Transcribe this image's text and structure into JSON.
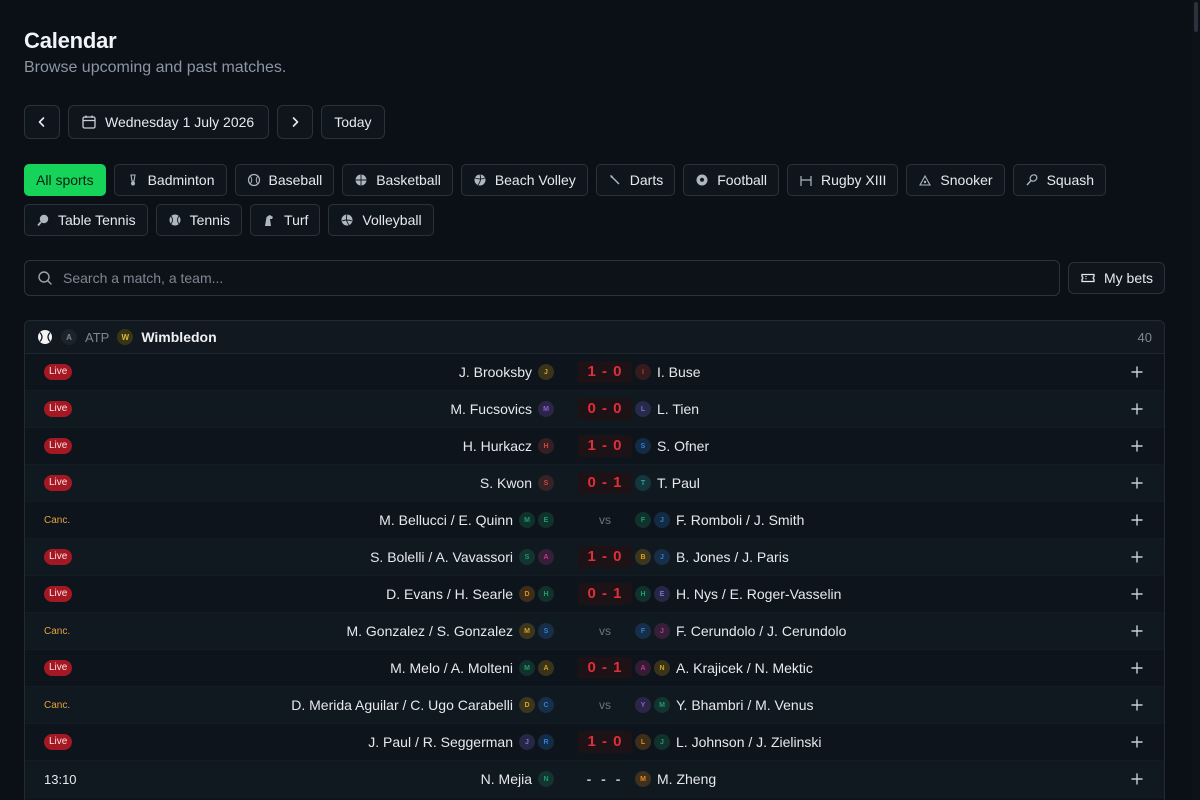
{
  "header": {
    "title": "Calendar",
    "subtitle": "Browse upcoming and past matches."
  },
  "datebar": {
    "date_label": "Wednesday 1 July 2026",
    "today_label": "Today"
  },
  "sports": [
    {
      "label": "All sports",
      "icon": "",
      "active": true
    },
    {
      "label": "Badminton",
      "icon": "badminton-icon"
    },
    {
      "label": "Baseball",
      "icon": "baseball-icon"
    },
    {
      "label": "Basketball",
      "icon": "basketball-icon"
    },
    {
      "label": "Beach Volley",
      "icon": "beach-volley-icon"
    },
    {
      "label": "Darts",
      "icon": "darts-icon"
    },
    {
      "label": "Football",
      "icon": "football-icon"
    },
    {
      "label": "Rugby XIII",
      "icon": "rugby-icon"
    },
    {
      "label": "Snooker",
      "icon": "snooker-icon"
    },
    {
      "label": "Squash",
      "icon": "squash-icon"
    },
    {
      "label": "Table Tennis",
      "icon": "table-tennis-icon"
    },
    {
      "label": "Tennis",
      "icon": "tennis-icon"
    },
    {
      "label": "Turf",
      "icon": "horse-icon"
    },
    {
      "label": "Volleyball",
      "icon": "volleyball-icon"
    }
  ],
  "search": {
    "placeholder": "Search a match, a team...",
    "value": ""
  },
  "my_bets": {
    "label": "My bets"
  },
  "tournament": {
    "circuit_badge": "A",
    "circuit": "ATP",
    "tournament_badge": "W",
    "name": "Wimbledon",
    "count": "40"
  },
  "colors": {
    "accent": "#16d35a",
    "live": "#a41823",
    "score": "#e02e3a",
    "cancelled": "#e6a23c",
    "background": "#0b1016"
  },
  "matches": [
    {
      "status": "Live",
      "status_type": "live",
      "home": "J. Brooksby",
      "home_badges": [
        {
          "l": "J",
          "c": "#d9a21b"
        }
      ],
      "result": "1 - 0",
      "result_type": "score",
      "away": "I. Buse",
      "away_badges": [
        {
          "l": "I",
          "c": "#c0392b"
        }
      ]
    },
    {
      "status": "Live",
      "status_type": "live",
      "home": "M. Fucsovics",
      "home_badges": [
        {
          "l": "M",
          "c": "#8e5bd6"
        }
      ],
      "result": "0 - 0",
      "result_type": "score",
      "away": "L. Tien",
      "away_badges": [
        {
          "l": "L",
          "c": "#7b6fd6"
        }
      ]
    },
    {
      "status": "Live",
      "status_type": "live",
      "home": "H. Hurkacz",
      "home_badges": [
        {
          "l": "H",
          "c": "#c44b3a"
        }
      ],
      "result": "1 - 0",
      "result_type": "score",
      "away": "S. Ofner",
      "away_badges": [
        {
          "l": "S",
          "c": "#2f7fd6"
        }
      ]
    },
    {
      "status": "Live",
      "status_type": "live",
      "home": "S. Kwon",
      "home_badges": [
        {
          "l": "S",
          "c": "#c44b3a"
        }
      ],
      "result": "0 - 1",
      "result_type": "score",
      "away": "T. Paul",
      "away_badges": [
        {
          "l": "T",
          "c": "#2aa5a0"
        }
      ]
    },
    {
      "status": "Canc.",
      "status_type": "canc",
      "home": "M. Bellucci / E. Quinn",
      "home_badges": [
        {
          "l": "M",
          "c": "#1f9d6b"
        },
        {
          "l": "E",
          "c": "#1f9d6b"
        }
      ],
      "result": "vs",
      "result_type": "vs",
      "away": "F. Romboli / J. Smith",
      "away_badges": [
        {
          "l": "F",
          "c": "#1f9d6b"
        },
        {
          "l": "J",
          "c": "#2f7fd6"
        }
      ]
    },
    {
      "status": "Live",
      "status_type": "live",
      "home": "S. Bolelli / A. Vavassori",
      "home_badges": [
        {
          "l": "S",
          "c": "#1f9d6b"
        },
        {
          "l": "A",
          "c": "#c0398b"
        }
      ],
      "result": "1 - 0",
      "result_type": "score",
      "away": "B. Jones / J. Paris",
      "away_badges": [
        {
          "l": "B",
          "c": "#d9a21b"
        },
        {
          "l": "J",
          "c": "#2f7fd6"
        }
      ]
    },
    {
      "status": "Live",
      "status_type": "live",
      "home": "D. Evans / H. Searle",
      "home_badges": [
        {
          "l": "D",
          "c": "#e68a1b"
        },
        {
          "l": "H",
          "c": "#1f9d6b"
        }
      ],
      "result": "0 - 1",
      "result_type": "score",
      "away": "H. Nys / E. Roger-Vasselin",
      "away_badges": [
        {
          "l": "H",
          "c": "#1f9d6b"
        },
        {
          "l": "E",
          "c": "#7b6fd6"
        }
      ]
    },
    {
      "status": "Canc.",
      "status_type": "canc",
      "home": "M. Gonzalez / S. Gonzalez",
      "home_badges": [
        {
          "l": "M",
          "c": "#d9a21b"
        },
        {
          "l": "S",
          "c": "#2f7fd6"
        }
      ],
      "result": "vs",
      "result_type": "vs",
      "away": "F. Cerundolo / J. Cerundolo",
      "away_badges": [
        {
          "l": "F",
          "c": "#2f7fd6"
        },
        {
          "l": "J",
          "c": "#c0398b"
        }
      ]
    },
    {
      "status": "Live",
      "status_type": "live",
      "home": "M. Melo / A. Molteni",
      "home_badges": [
        {
          "l": "M",
          "c": "#1f9d6b"
        },
        {
          "l": "A",
          "c": "#d9a21b"
        }
      ],
      "result": "0 - 1",
      "result_type": "score",
      "away": "A. Krajicek / N. Mektic",
      "away_badges": [
        {
          "l": "A",
          "c": "#c0398b"
        },
        {
          "l": "N",
          "c": "#d9a21b"
        }
      ]
    },
    {
      "status": "Canc.",
      "status_type": "canc",
      "home": "D. Merida Aguilar / C. Ugo Carabelli",
      "home_badges": [
        {
          "l": "D",
          "c": "#d9a21b"
        },
        {
          "l": "C",
          "c": "#2f7fd6"
        }
      ],
      "result": "vs",
      "result_type": "vs",
      "away": "Y. Bhambri / M. Venus",
      "away_badges": [
        {
          "l": "Y",
          "c": "#8e5bd6"
        },
        {
          "l": "M",
          "c": "#1f9d6b"
        }
      ]
    },
    {
      "status": "Live",
      "status_type": "live",
      "home": "J. Paul / R. Seggerman",
      "home_badges": [
        {
          "l": "J",
          "c": "#7b6fd6"
        },
        {
          "l": "R",
          "c": "#2f7fd6"
        }
      ],
      "result": "1 - 0",
      "result_type": "score",
      "away": "L. Johnson / J. Zielinski",
      "away_badges": [
        {
          "l": "L",
          "c": "#e68a1b"
        },
        {
          "l": "J",
          "c": "#1f9d6b"
        }
      ]
    },
    {
      "status": "13:10",
      "status_type": "time",
      "home": "N. Mejia",
      "home_badges": [
        {
          "l": "N",
          "c": "#1f9d6b"
        }
      ],
      "result": "- - -",
      "result_type": "dash",
      "away": "M. Zheng",
      "away_badges": [
        {
          "l": "M",
          "c": "#e68a1b"
        }
      ]
    }
  ]
}
